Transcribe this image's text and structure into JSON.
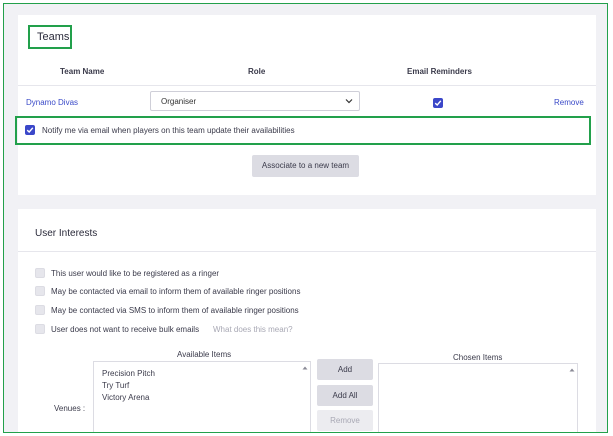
{
  "teams": {
    "title": "Teams",
    "columns": [
      "Team Name",
      "Role",
      "Email Reminders"
    ],
    "rows": [
      {
        "team_name": "Dynamo Divas",
        "role": "Organiser",
        "email_reminders": true,
        "remove_label": "Remove"
      }
    ],
    "notify_label": "Notify me via email when players on this team update their availabilities",
    "notify_checked": true,
    "associate_label": "Associate to a new team"
  },
  "interests": {
    "title": "User Interests",
    "options": [
      {
        "label": "This user would like to be registered as a ringer",
        "checked": false
      },
      {
        "label": "May be contacted via email to inform them of available ringer positions",
        "checked": false
      },
      {
        "label": "May be contacted via SMS to inform them of available ringer positions",
        "checked": false
      },
      {
        "label": "User does not want to receive bulk emails",
        "checked": false,
        "help": "What does this mean?"
      }
    ],
    "venues_label": "Venues :",
    "available_header": "Available Items",
    "chosen_header": "Chosen Items",
    "available_items": [
      "Precision Pitch",
      "Try Turf",
      "Victory Arena"
    ],
    "chosen_items": [],
    "add_label": "Add",
    "add_all_label": "Add All",
    "remove_label": "Remove"
  },
  "colors": {
    "accent": "#3b47c9",
    "highlight_border": "#22a04b",
    "link": "#3a4ac8"
  }
}
